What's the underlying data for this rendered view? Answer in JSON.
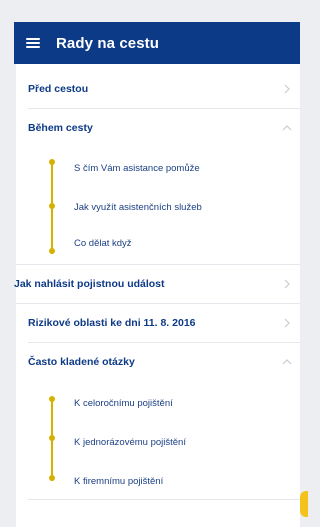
{
  "header": {
    "title": "Rady na cestu"
  },
  "sections": [
    {
      "label": "Před cestou",
      "expanded": false
    },
    {
      "label": "Během cesty",
      "expanded": true,
      "items": [
        "S čím Vám asistance pomůže",
        "Jak využít asistenčních služeb",
        "Co dělat když"
      ]
    },
    {
      "label": "Jak nahlásit pojistnou událost",
      "expanded": false
    },
    {
      "label": "Rizikové oblasti ke dni 11. 8. 2016",
      "expanded": false
    },
    {
      "label": "Často kladené otázky",
      "expanded": true,
      "items": [
        "K celoročnímu pojištění",
        "K jednorázovému pojištění",
        "K firemnímu pojištění"
      ]
    }
  ],
  "colors": {
    "header": "#0d3a86",
    "accent": "#d6b100",
    "fab": "#f3c21b"
  }
}
